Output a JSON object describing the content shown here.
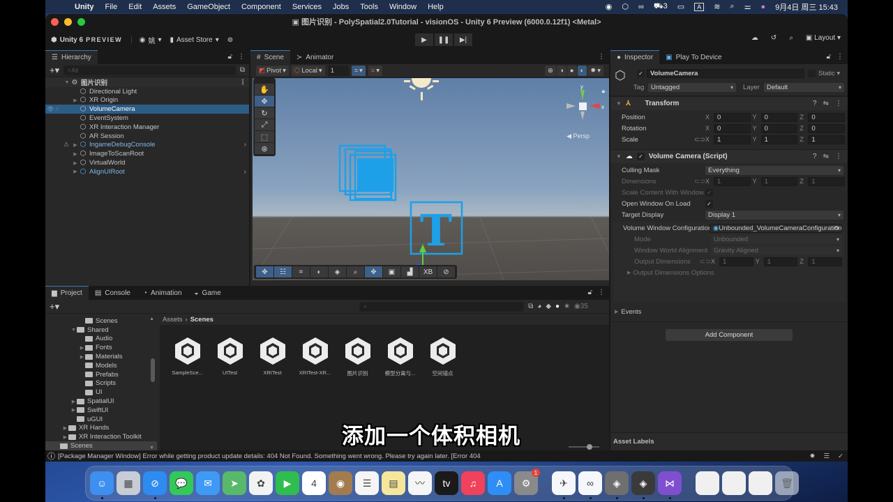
{
  "menubar": {
    "app": "Unity",
    "items": [
      "File",
      "Edit",
      "Assets",
      "GameObject",
      "Component",
      "Services",
      "Jobs",
      "Tools",
      "Window",
      "Help"
    ],
    "status_badge_count": "3",
    "input_method": "A",
    "datetime": "9月4日 周三  15:43"
  },
  "window": {
    "title": "图片识别 - PolySpatial2.0Tutorial - visionOS - Unity 6 Preview (6000.0.12f1) <Metal>"
  },
  "toolbar": {
    "brand": "Unity 6",
    "brand_suffix": "PREVIEW",
    "account": "姚",
    "asset_store": "Asset Store",
    "layout": "Layout"
  },
  "hierarchy": {
    "tab": "Hierarchy",
    "search_placeholder": "All",
    "scene": "图片识别",
    "items": [
      {
        "name": "Directional Light",
        "expand": false,
        "prefab": false
      },
      {
        "name": "XR Origin",
        "expand": true,
        "prefab": false
      },
      {
        "name": "VolumeCamera",
        "expand": false,
        "prefab": false,
        "selected": true
      },
      {
        "name": "EventSystem",
        "expand": false,
        "prefab": false
      },
      {
        "name": "XR Interaction Manager",
        "expand": false,
        "prefab": false
      },
      {
        "name": "AR Session",
        "expand": false,
        "prefab": false
      },
      {
        "name": "IngameDebugConsole",
        "expand": true,
        "prefab": true,
        "warning": true
      },
      {
        "name": "ImageToScanRoot",
        "expand": true,
        "prefab": false
      },
      {
        "name": "VirtualWorld",
        "expand": true,
        "prefab": false
      },
      {
        "name": "AlignUIRoot",
        "expand": true,
        "prefab": true
      }
    ]
  },
  "scene": {
    "tabs": [
      "Scene",
      "Animator"
    ],
    "pivot": "Pivot",
    "local": "Local",
    "grid_size": "1",
    "persp": "Persp",
    "gizmo_y": "y",
    "gizmo_x": "x",
    "overlay_xb": "XB"
  },
  "inspector": {
    "tabs": [
      "Inspector",
      "Play To Device"
    ],
    "object_name": "VolumeCamera",
    "static_label": "Static",
    "tag_label": "Tag",
    "tag_value": "Untagged",
    "layer_label": "Layer",
    "layer_value": "Default",
    "transform": {
      "title": "Transform",
      "rows": [
        {
          "label": "Position",
          "x": "0",
          "y": "0",
          "z": "0"
        },
        {
          "label": "Rotation",
          "x": "0",
          "y": "0",
          "z": "0"
        },
        {
          "label": "Scale",
          "x": "1",
          "y": "1",
          "z": "1"
        }
      ]
    },
    "volume_camera": {
      "title": "Volume Camera (Script)",
      "culling_mask_label": "Culling Mask",
      "culling_mask_value": "Everything",
      "dimensions_label": "Dimensions",
      "dimensions": {
        "x": "1",
        "y": "1",
        "z": "1"
      },
      "scale_content_label": "Scale Content With Window",
      "open_window_label": "Open Window On Load",
      "target_display_label": "Target Display",
      "target_display_value": "Display 1",
      "config_label": "Volume Window Configuration",
      "config_value": "Unbounded_VolumeCameraConfiguration",
      "mode_label": "Mode",
      "mode_value": "Unbounded",
      "alignment_label": "Window World Alignment",
      "alignment_value": "Gravity Aligned",
      "output_dim_label": "Output Dimensions",
      "output_dim": {
        "x": "1",
        "y": "1",
        "z": "1"
      },
      "output_dim_options": "Output Dimensions Options"
    },
    "events_label": "Events",
    "add_component": "Add Component",
    "asset_labels": "Asset Labels"
  },
  "project": {
    "tabs": [
      "Project",
      "Console",
      "Animation",
      "Game"
    ],
    "hidden_count": "35",
    "tree": [
      {
        "name": "Scenes",
        "depth": 2,
        "arrow": ""
      },
      {
        "name": "Shared",
        "depth": 1,
        "arrow": "▼",
        "open": true
      },
      {
        "name": "Audio",
        "depth": 2,
        "arrow": ""
      },
      {
        "name": "Fonts",
        "depth": 2,
        "arrow": "▶"
      },
      {
        "name": "Materials",
        "depth": 2,
        "arrow": "▶"
      },
      {
        "name": "Models",
        "depth": 2,
        "arrow": ""
      },
      {
        "name": "Prefabs",
        "depth": 2,
        "arrow": ""
      },
      {
        "name": "Scripts",
        "depth": 2,
        "arrow": ""
      },
      {
        "name": "UI",
        "depth": 2,
        "arrow": ""
      },
      {
        "name": "SpatialUI",
        "depth": 1,
        "arrow": "▶"
      },
      {
        "name": "SwiftUI",
        "depth": 1,
        "arrow": "▶"
      },
      {
        "name": "uGUI",
        "depth": 1,
        "arrow": ""
      },
      {
        "name": "XR Hands",
        "depth": 0,
        "arrow": "▶"
      },
      {
        "name": "XR Interaction Toolkit",
        "depth": 0,
        "arrow": "▶"
      },
      {
        "name": "Scenes",
        "depth": -1,
        "arrow": "",
        "selected": true
      }
    ],
    "breadcrumb_root": "Assets",
    "breadcrumb_current": "Scenes",
    "assets": [
      "SampleSce...",
      "UITest",
      "XRITest",
      "XRITest-XR...",
      "图片识别",
      "模型分离与...",
      "空间锚点"
    ]
  },
  "status": {
    "message": "[Package Manager Window] Error while getting product update details: 404 Not Found. Something went wrong. Please try again later. [Error 404"
  },
  "subtitle": "添加一个体积相机",
  "dock": {
    "apps": [
      {
        "name": "finder",
        "color": "#3d8ff0",
        "glyph": "☺",
        "running": true
      },
      {
        "name": "launchpad",
        "color": "#c8ccd4",
        "glyph": "▦"
      },
      {
        "name": "safari",
        "color": "#2e8cf0",
        "glyph": "⊘",
        "running": true
      },
      {
        "name": "messages",
        "color": "#34c759",
        "glyph": "💬"
      },
      {
        "name": "mail",
        "color": "#3e9af5",
        "glyph": "✉"
      },
      {
        "name": "maps",
        "color": "#59b96a",
        "glyph": "➤"
      },
      {
        "name": "photos",
        "color": "#f2f2f2",
        "glyph": "✿"
      },
      {
        "name": "facetime",
        "color": "#2fbd4f",
        "glyph": "▶"
      },
      {
        "name": "calendar",
        "color": "#ffffff",
        "glyph": "4"
      },
      {
        "name": "contacts",
        "color": "#a27b4f",
        "glyph": "◉"
      },
      {
        "name": "reminders",
        "color": "#f5f5f5",
        "glyph": "☰"
      },
      {
        "name": "notes",
        "color": "#f6e69b",
        "glyph": "▤"
      },
      {
        "name": "freeform",
        "color": "#f5f5f5",
        "glyph": "〰"
      },
      {
        "name": "apple-tv",
        "color": "#1a1a1a",
        "glyph": "tv"
      },
      {
        "name": "music",
        "color": "#f0425a",
        "glyph": "♫"
      },
      {
        "name": "app-store",
        "color": "#2e8ef5",
        "glyph": "A"
      },
      {
        "name": "system-settings",
        "color": "#8a8a8a",
        "glyph": "⚙",
        "badge": "1"
      }
    ],
    "apps2": [
      {
        "name": "feishu",
        "color": "#f5f7fb",
        "glyph": "✈",
        "running": true
      },
      {
        "name": "baidu-netdisk",
        "color": "#f5f7fb",
        "glyph": "∞",
        "running": true
      },
      {
        "name": "unity-hub",
        "color": "#6f6f6f",
        "glyph": "◈",
        "running": true
      },
      {
        "name": "unity",
        "color": "#3a3a3a",
        "glyph": "◈",
        "running": true
      },
      {
        "name": "visual-studio",
        "color": "#7f4fcf",
        "glyph": "⋈",
        "running": true
      }
    ]
  }
}
